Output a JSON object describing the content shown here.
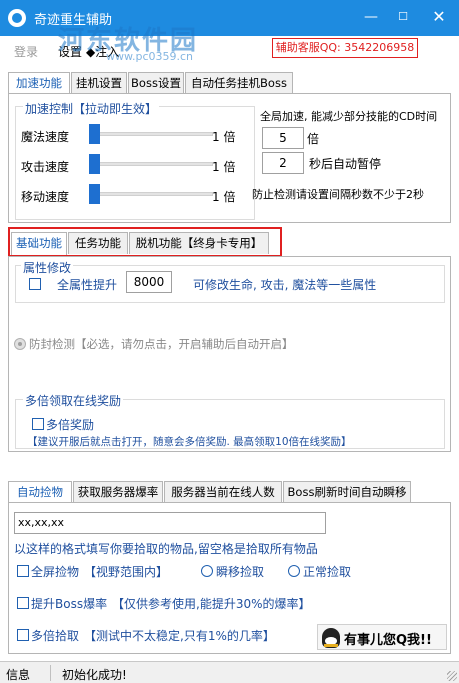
{
  "window": {
    "title": "奇迹重生辅助",
    "minimize_icon": "minimize-icon",
    "maximize_icon": "maximize-icon",
    "close_icon": "close-icon",
    "minimize_glyph": "—",
    "maximize_glyph": "☐",
    "close_glyph": "✕"
  },
  "watermark": {
    "text": "河东软件园",
    "url": "www.pc0359.cn"
  },
  "menu": {
    "login": "登录",
    "settings": "设置",
    "inject": "◆注入"
  },
  "support": "辅助客服QQ: 3542206958",
  "top_tabs": [
    "加速功能",
    "挂机设置",
    "Boss设置",
    "自动任务挂机Boss"
  ],
  "speed": {
    "group_title": "加速控制【拉动即生效】",
    "sliders": [
      {
        "label": "魔法速度",
        "value": 1,
        "unit_text": "1 倍"
      },
      {
        "label": "攻击速度",
        "value": 1,
        "unit_text": "1 倍"
      },
      {
        "label": "移动速度",
        "value": 1,
        "unit_text": "1 倍"
      }
    ]
  },
  "global_speed": {
    "title": "全局加速, 能减少部分技能的CD时间",
    "multiplier_value": "5",
    "multiplier_unit": "倍",
    "pause_value": "2",
    "pause_text": "秒后自动暂停",
    "warning": "防止检测请设置间隔秒数不少于2秒"
  },
  "mid_tabs": [
    "基础功能",
    "任务功能",
    "脱机功能【终身卡专用】"
  ],
  "attributes": {
    "group_title": "属性修改",
    "checkbox_label": "全属性提升",
    "value": "8000",
    "description": "可修改生命, 攻击, 魔法等一些属性"
  },
  "anti_ban": "防封检测【必选，请勿点击，开启辅助后自动开启】",
  "multi_reward": {
    "group_title": "多倍领取在线奖励",
    "checkbox_label": "多倍奖励",
    "note": "【建议开服后就点击打开，随意会多倍奖励. 最高领取10倍在线奖励】"
  },
  "bottom_tabs": [
    "自动捡物",
    "获取服务器爆率",
    "服务器当前在线人数",
    "Boss刷新时间自动瞬移"
  ],
  "pickup": {
    "input_value": "xx,xx,xx",
    "hint": "以这样的格式填写你要拾取的物品,留空格是拾取所有物品",
    "fullscreen_label": "全屏捡物",
    "fullscreen_note": "【视野范围内】",
    "radio_teleport": "瞬移捡取",
    "radio_normal": "正常捡取",
    "boss_label": "提升Boss爆率",
    "boss_note": "【仅供参考使用,能提升30%的爆率】",
    "multi_label": "多倍拾取",
    "multi_note": "【测试中不太稳定,只有1%的几率】"
  },
  "qq_widget": {
    "text": "有事儿您Q我!!",
    "icon": "qq-penguin-icon"
  },
  "status": {
    "label": "信息",
    "message": "初始化成功!"
  },
  "colors": {
    "titlebar": "#1e8be0",
    "accent_blue": "#1f4f9e",
    "highlight_red": "#e02020",
    "slider_thumb": "#1e6fd0"
  }
}
